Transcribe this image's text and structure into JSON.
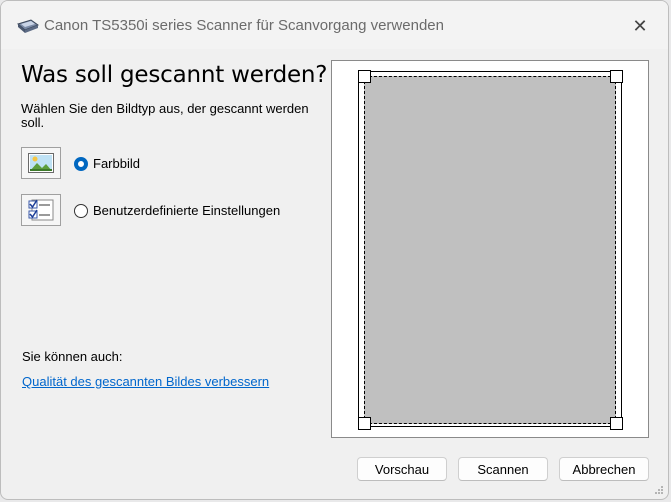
{
  "window": {
    "title": "Canon TS5350i series Scanner für Scanvorgang verwenden",
    "close_glyph": "✕"
  },
  "main": {
    "heading": "Was soll gescannt werden?",
    "instruction": "Wählen Sie den Bildtyp aus, der gescannt werden soll.",
    "options": [
      {
        "label": "Farbbild",
        "selected": true,
        "icon": "color-picture-icon"
      },
      {
        "label": "Benutzerdefinierte Einstellungen",
        "selected": false,
        "icon": "custom-settings-icon"
      }
    ],
    "also_label": "Sie können auch:",
    "quality_link": "Qualität des gescannten Bildes verbessern"
  },
  "buttons": {
    "preview": "Vorschau",
    "scan": "Scannen",
    "cancel": "Abbrechen"
  },
  "colors": {
    "accent": "#0067c0",
    "link": "#0066cc",
    "scan_area": "#c0c0c0"
  }
}
